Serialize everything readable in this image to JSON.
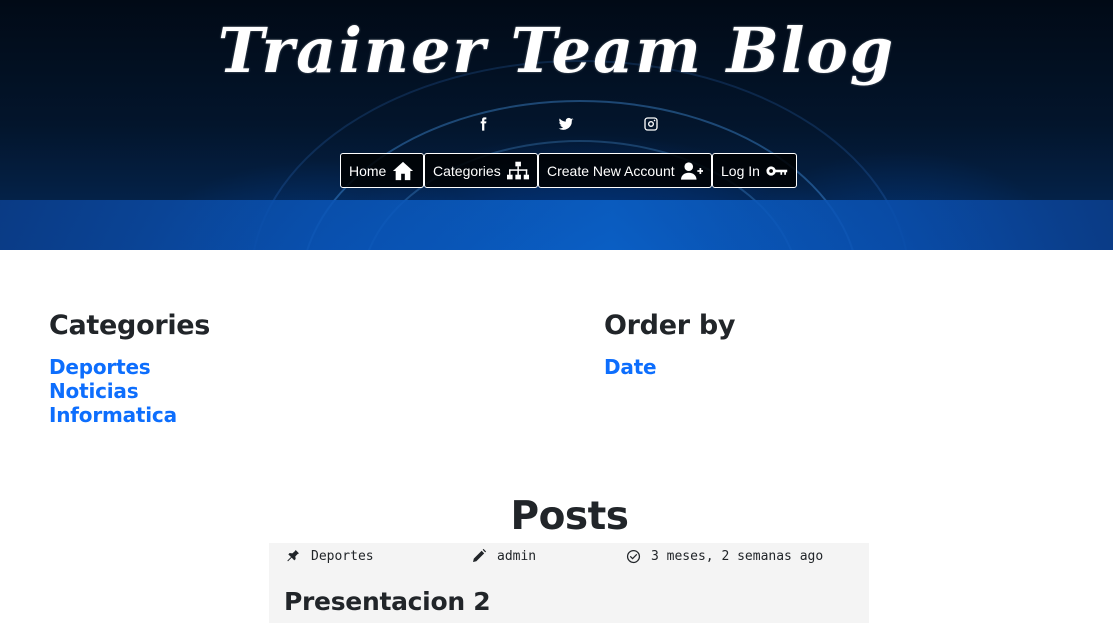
{
  "header": {
    "site_title": "Trainer Team Blog",
    "social": [
      "facebook-icon",
      "twitter-icon",
      "instagram-icon"
    ],
    "nav": {
      "home": "Home",
      "categories": "Categories",
      "create_account": "Create New Account",
      "login": "Log In"
    }
  },
  "categories": {
    "title": "Categories",
    "items": [
      "Deportes",
      "Noticias",
      "Informatica"
    ]
  },
  "order_by": {
    "title": "Order by",
    "items": [
      "Date"
    ]
  },
  "posts": {
    "title": "Posts",
    "items": [
      {
        "category": "Deportes",
        "author": "admin",
        "time": "3 meses, 2 semanas ago",
        "title": "Presentacion 2"
      }
    ]
  },
  "colors": {
    "link": "#0d6efd",
    "text": "#212529",
    "card_bg": "#f4f4f4",
    "hero_dark": "#03152c",
    "hero_blue": "#0b63cc"
  }
}
